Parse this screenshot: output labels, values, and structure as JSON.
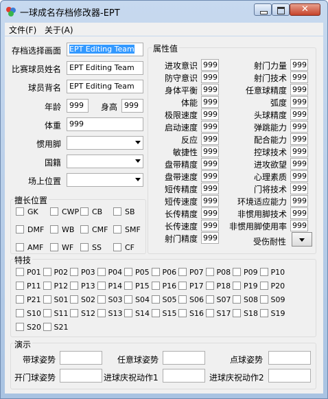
{
  "window": {
    "title": "一球成名存档修改器-EPT"
  },
  "menu": {
    "file": "文件(F)",
    "about": "关于(A)"
  },
  "left": {
    "save_select_label": "存档选择画面",
    "save_select_value": "EPT Editing Team",
    "player_name_label": "比赛球员姓名",
    "player_name_value": "EPT Editing Team",
    "back_name_label": "球员背名",
    "back_name_value": "EPT Editing Team",
    "age_label": "年龄",
    "age_value": "999",
    "height_label": "身高",
    "height_value": "999",
    "weight_label": "体重",
    "weight_value": "999",
    "foot_label": "惯用脚",
    "nation_label": "国籍",
    "position_label": "场上位置"
  },
  "positions": {
    "title": "擅长位置",
    "items": [
      "GK",
      "CWP",
      "CB",
      "SB",
      "DMF",
      "WB",
      "CMF",
      "SMF",
      "AMF",
      "WF",
      "SS",
      "CF"
    ]
  },
  "attributes": {
    "title": "属性值",
    "left": [
      {
        "label": "进攻意识",
        "value": "999"
      },
      {
        "label": "防守意识",
        "value": "999"
      },
      {
        "label": "身体平衡",
        "value": "999"
      },
      {
        "label": "体能",
        "value": "999"
      },
      {
        "label": "极限速度",
        "value": "999"
      },
      {
        "label": "启动速度",
        "value": "999"
      },
      {
        "label": "反应",
        "value": "999"
      },
      {
        "label": "敏捷性",
        "value": "999"
      },
      {
        "label": "盘带精度",
        "value": "999"
      },
      {
        "label": "盘带速度",
        "value": "999"
      },
      {
        "label": "短传精度",
        "value": "999"
      },
      {
        "label": "短传速度",
        "value": "999"
      },
      {
        "label": "长传精度",
        "value": "999"
      },
      {
        "label": "长传速度",
        "value": "999"
      },
      {
        "label": "射门精度",
        "value": "999"
      }
    ],
    "right": [
      {
        "label": "射门力量",
        "value": "999"
      },
      {
        "label": "射门技术",
        "value": "999"
      },
      {
        "label": "任意球精度",
        "value": "999"
      },
      {
        "label": "弧度",
        "value": "999"
      },
      {
        "label": "头球精度",
        "value": "999"
      },
      {
        "label": "弹跳能力",
        "value": "999"
      },
      {
        "label": "配合能力",
        "value": "999"
      },
      {
        "label": "控球技术",
        "value": "999"
      },
      {
        "label": "进攻欲望",
        "value": "999"
      },
      {
        "label": "心理素质",
        "value": "999"
      },
      {
        "label": "门将技术",
        "value": "999"
      },
      {
        "label": "环境适应能力",
        "value": "999"
      },
      {
        "label": "非惯用脚技术",
        "value": "999"
      },
      {
        "label": "非惯用脚使用率",
        "value": "999"
      }
    ],
    "injury_label": "受伤耐性"
  },
  "skills": {
    "title": "特技",
    "items": [
      "P01",
      "P02",
      "P03",
      "P04",
      "P05",
      "P06",
      "P07",
      "P08",
      "P09",
      "P10",
      "P11",
      "P12",
      "P13",
      "P14",
      "P15",
      "P16",
      "P17",
      "P18",
      "P19",
      "P20",
      "P21",
      "S01",
      "S02",
      "S03",
      "S04",
      "S05",
      "S06",
      "S07",
      "S08",
      "S09",
      "S10",
      "S11",
      "S12",
      "S13",
      "S14",
      "S15",
      "S16",
      "S17",
      "S18",
      "S19",
      "S20",
      "S21"
    ]
  },
  "demo": {
    "title": "演示",
    "dribble": "带球姿势",
    "freekick": "任意球姿势",
    "penalty": "点球姿势",
    "kickoff": "开门球姿势",
    "celebrate1": "进球庆祝动作1",
    "celebrate2": "进球庆祝动作2"
  }
}
